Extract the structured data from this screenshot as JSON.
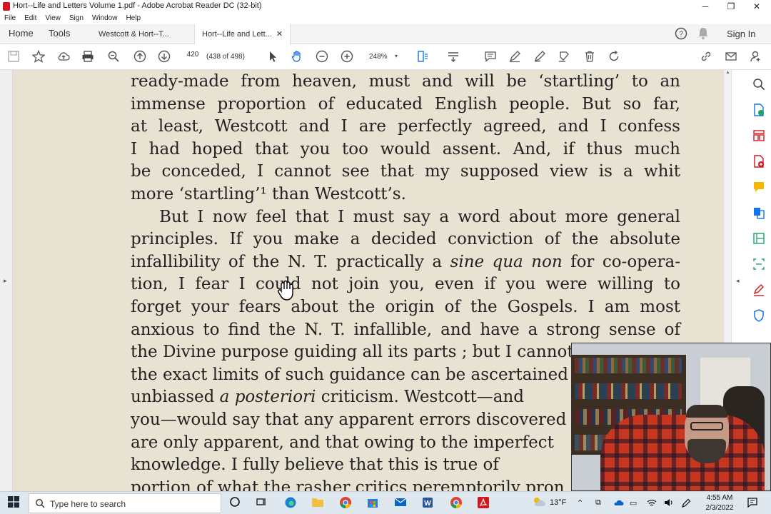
{
  "window": {
    "title": "Hort--Life and Letters Volume 1.pdf - Adobe Acrobat Reader DC (32-bit)",
    "controls": {
      "minimize": "─",
      "maximize": "❐",
      "close": "✕"
    }
  },
  "menu": [
    "File",
    "Edit",
    "View",
    "Sign",
    "Window",
    "Help"
  ],
  "tabs": {
    "home": "Home",
    "tools": "Tools",
    "doc1": "Westcott & Hort--T...",
    "doc2": "Hort--Life and Lett...",
    "close": "✕",
    "sign_in": "Sign In"
  },
  "toolbar": {
    "page_number": "420",
    "page_count": "(438 of 498)",
    "zoom": "248%",
    "zoom_caret": "▾"
  },
  "document": {
    "lines": [
      "ready-made from heaven, must and will be ‘startling’ to an",
      "immense proportion of educated English people.  But so far,",
      "at least, Westcott and I are perfectly agreed, and I confess",
      "I had hoped that you too would assent.  And, if thus much",
      "be conceded, I cannot see that my supposed view is a whit",
      "more ‘startling’¹ than Westcott’s.",
      "But I now feel that I must say a word about more general",
      "principles.  If you make a decided conviction of the absolute",
      "infallibility of the N. T. practically a sine qua non for co-opera-",
      "tion, I fear I could not join you, even if you were willing to",
      "forget your fears about the origin of the Gospels.  I am most",
      "anxious to find the N. T. infallible, and have a strong sense of",
      "the Divine purpose guiding all its parts ; but I cannot",
      "the exact limits of such guidance can be ascertained",
      "unbiassed a posteriori criticism.  Westcott—and",
      "you—would say that any apparent errors discovered",
      "are only apparent, and that owing to the imperfect",
      "knowledge.  I fully believe that this is true of",
      "portion of what the rasher critics peremptorily pron"
    ]
  },
  "taskbar": {
    "search_placeholder": "Type here to search",
    "weather": "13°F",
    "time": "4:55 AM",
    "date": "2/3/2022"
  },
  "colors": {
    "page_bg": "#e8e2d2",
    "acrobat_red": "#d4171e",
    "accent_blue": "#1473e6"
  }
}
